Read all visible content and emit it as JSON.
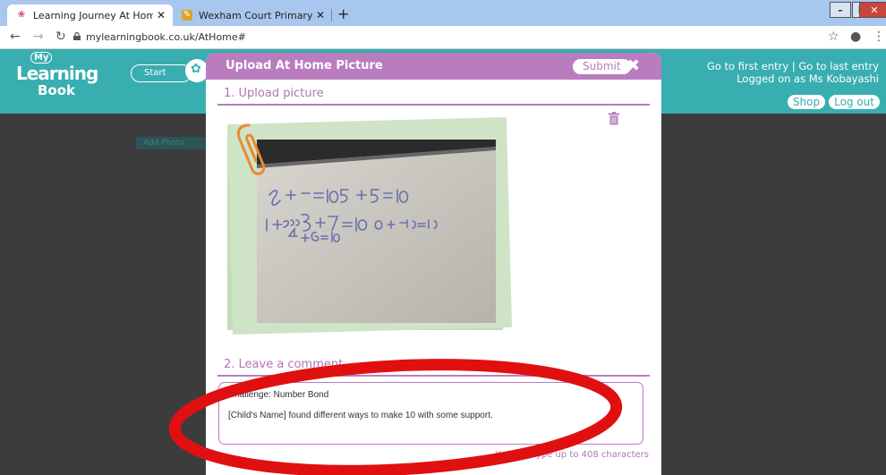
{
  "browser": {
    "tabs": [
      {
        "title": "Learning Journey At Home",
        "active": true
      },
      {
        "title": "Wexham Court Primary - Homew",
        "active": false
      }
    ],
    "tab_close": "✕",
    "new_tab": "+",
    "url": "mylearningbook.co.uk/AtHome#"
  },
  "site": {
    "logo": {
      "line1": "My",
      "line2": "Learning",
      "line3": "Book"
    },
    "start_label": "Start",
    "nav_first": "Go to first entry",
    "nav_sep": "|",
    "nav_last": "Go to last entry",
    "logged_on": "Logged on as Ms Kobayashi",
    "shop": "Shop",
    "logout": "Log out",
    "add_photo": "Add Photo"
  },
  "modal": {
    "title": "Upload At Home Picture",
    "submit": "Submit",
    "section1": "1. Upload picture",
    "section2": "2. Leave a comment",
    "comment_line1": "Challenge: Number Bond",
    "comment_line2": "[Child's Name] found different ways to make 10 with some support.",
    "char_count": "You can type up to 408 characters"
  },
  "colors": {
    "header_teal": "#39aeb0",
    "modal_purple": "#b97dbf",
    "annotation_red": "#e01010"
  }
}
